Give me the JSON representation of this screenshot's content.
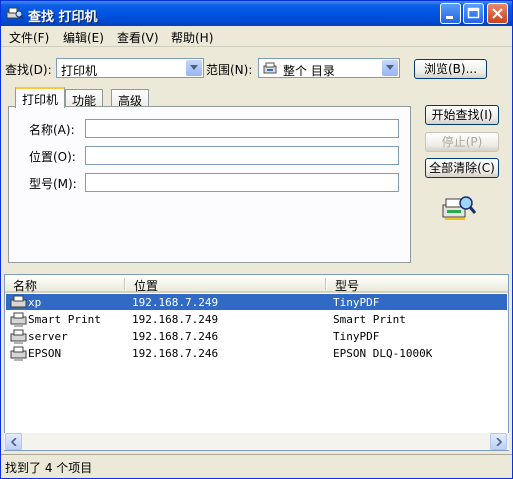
{
  "window": {
    "title": "查找 打印机",
    "minimize_label": "_",
    "maximize_label": "□",
    "close_label": "×"
  },
  "menu": [
    {
      "label": "文件(F)"
    },
    {
      "label": "编辑(E)"
    },
    {
      "label": "查看(V)"
    },
    {
      "label": "帮助(H)"
    }
  ],
  "search": {
    "find_label": "查找(D):",
    "find_value": "打印机",
    "scope_label": "范围(N):",
    "scope_value": "整个 目录",
    "browse_label": "浏览(B)..."
  },
  "tabs": [
    {
      "label": "打印机",
      "active": true
    },
    {
      "label": "功能",
      "active": false
    },
    {
      "label": "高级",
      "active": false
    }
  ],
  "form": {
    "name_label": "名称(A):",
    "name_value": "",
    "location_label": "位置(O):",
    "location_value": "",
    "model_label": "型号(M):",
    "model_value": ""
  },
  "actions": {
    "find_now": "开始查找(I)",
    "stop": "停止(P)",
    "clear_all": "全部清除(C)"
  },
  "results": {
    "columns": [
      "名称",
      "位置",
      "型号"
    ],
    "rows": [
      {
        "name": "xp",
        "location": "192.168.7.249",
        "model": "TinyPDF",
        "selected": true
      },
      {
        "name": "Smart Print",
        "location": "192.168.7.249",
        "model": "Smart Print",
        "selected": false
      },
      {
        "name": "server",
        "location": "192.168.7.246",
        "model": "TinyPDF",
        "selected": false
      },
      {
        "name": "EPSON",
        "location": "192.168.7.246",
        "model": "EPSON DLQ-1000K",
        "selected": false
      }
    ]
  },
  "status": {
    "text": "找到了 4 个项目"
  },
  "colors": {
    "titlebar": "#0055e3",
    "selection": "#316ac5",
    "face": "#ece9d8"
  }
}
